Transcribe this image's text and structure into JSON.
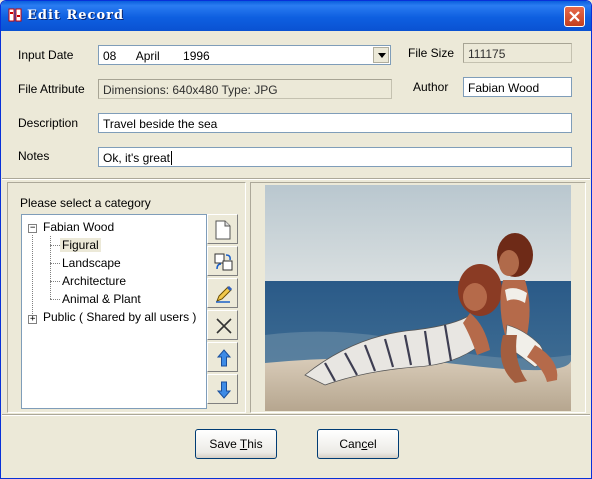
{
  "window": {
    "title": "Edit Record"
  },
  "form": {
    "input_date_label": "Input Date",
    "input_date_value": "08      April       1996",
    "file_size_label": "File Size",
    "file_size_value": "111175",
    "file_attribute_label": "File Attribute",
    "file_attribute_value": "Dimensions: 640x480  Type: JPG",
    "author_label": "Author",
    "author_value": "Fabian Wood",
    "description_label": "Description",
    "description_value": "Travel beside the sea",
    "notes_label": "Notes",
    "notes_value": "Ok, it's great"
  },
  "category": {
    "prompt": "Please select a category",
    "tree": {
      "root1": "Fabian Wood",
      "children": [
        "Figural",
        "Landscape",
        "Architecture",
        "Animal & Plant"
      ],
      "root2": "Public ( Shared by all users )"
    }
  },
  "toolbar": {
    "icons": [
      "new-icon",
      "copy-icon",
      "edit-icon",
      "delete-icon",
      "move-up-icon",
      "move-down-icon"
    ]
  },
  "buttons": {
    "save_prefix": "Save ",
    "save_accel": "T",
    "save_suffix": "his",
    "cancel_prefix": "Can",
    "cancel_accel": "c",
    "cancel_suffix": "el"
  },
  "colors": {
    "titlebar": "#0a5fdc",
    "dialog_bg": "#ece9d8",
    "close_button": "#c33f1f"
  }
}
